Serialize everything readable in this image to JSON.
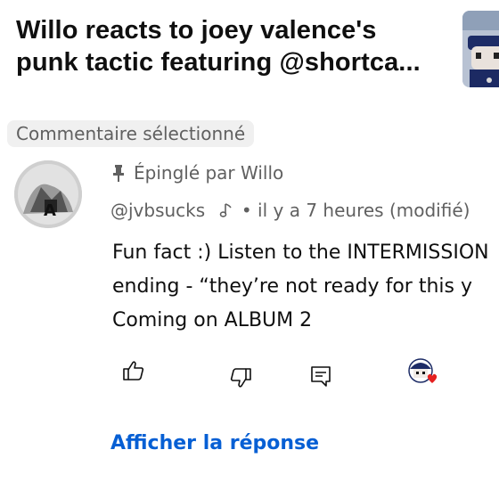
{
  "video": {
    "title_line1": "Willo reacts to joey valence's",
    "title_line2": "punk tactic featuring @shortca..."
  },
  "section_chip": "Commentaire sélectionné",
  "comment": {
    "pinned_label": "Épinglé par Willo",
    "author": "@jvbsucks",
    "time_info": "• il y a 7 heures (modifié)",
    "lines": [
      "Fun fact :) Listen to the INTERMISSION",
      "ending - “they’re not ready for this y",
      "Coming on ALBUM 2"
    ]
  },
  "actions": {
    "like_icon": "thumbs-up-icon",
    "dislike_icon": "thumbs-down-icon",
    "reply_icon": "comment-icon",
    "heart_icon": "creator-heart-icon"
  },
  "show_reply": "Afficher la réponse",
  "colors": {
    "link": "#065fd4",
    "secondary_text": "#606060",
    "chip_bg": "#f0f0f0",
    "heart": "#e52020"
  }
}
